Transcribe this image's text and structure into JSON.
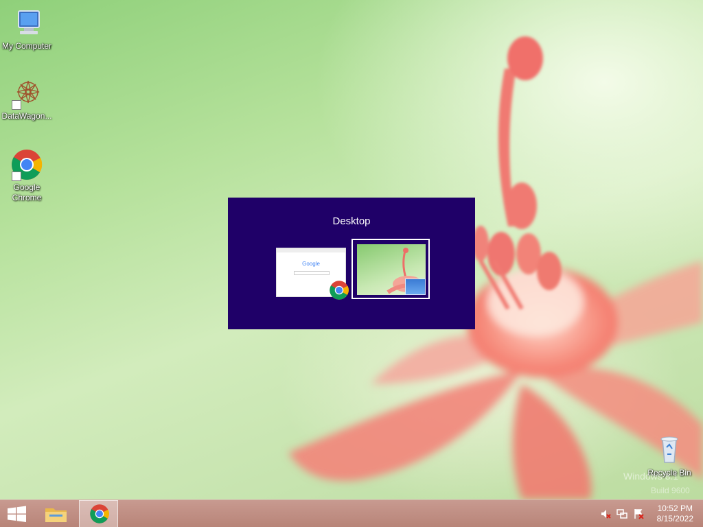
{
  "desktop": {
    "icons": [
      {
        "label": "My Computer",
        "icon": "computer-icon"
      },
      {
        "label": "DataWagon...",
        "icon": "datawagon-icon"
      },
      {
        "label": "Google\nChrome",
        "icon": "chrome-icon"
      },
      {
        "label": "Recycle Bin",
        "icon": "recycle-bin-icon"
      }
    ],
    "watermark_line1": "Windows 8.1",
    "watermark_line2": "Build 9600"
  },
  "task_switcher": {
    "title": "Desktop",
    "items": [
      {
        "name": "Google Chrome",
        "icon": "chrome-icon",
        "thumb_text": "Google"
      },
      {
        "name": "Desktop",
        "icon": "desktop-icon",
        "selected": true
      }
    ]
  },
  "taskbar": {
    "start_icon": "windows-start-icon",
    "pinned": [
      {
        "name": "File Explorer",
        "icon": "folder-icon"
      },
      {
        "name": "Google Chrome",
        "icon": "chrome-icon",
        "active": true
      }
    ],
    "tray": {
      "icons": [
        "speaker-muted-icon",
        "network-icon",
        "action-center-icon"
      ],
      "time": "10:52 PM",
      "date": "8/15/2022"
    }
  },
  "colors": {
    "switcher_bg": "#1f0068",
    "taskbar_bg": "#c89a90"
  }
}
